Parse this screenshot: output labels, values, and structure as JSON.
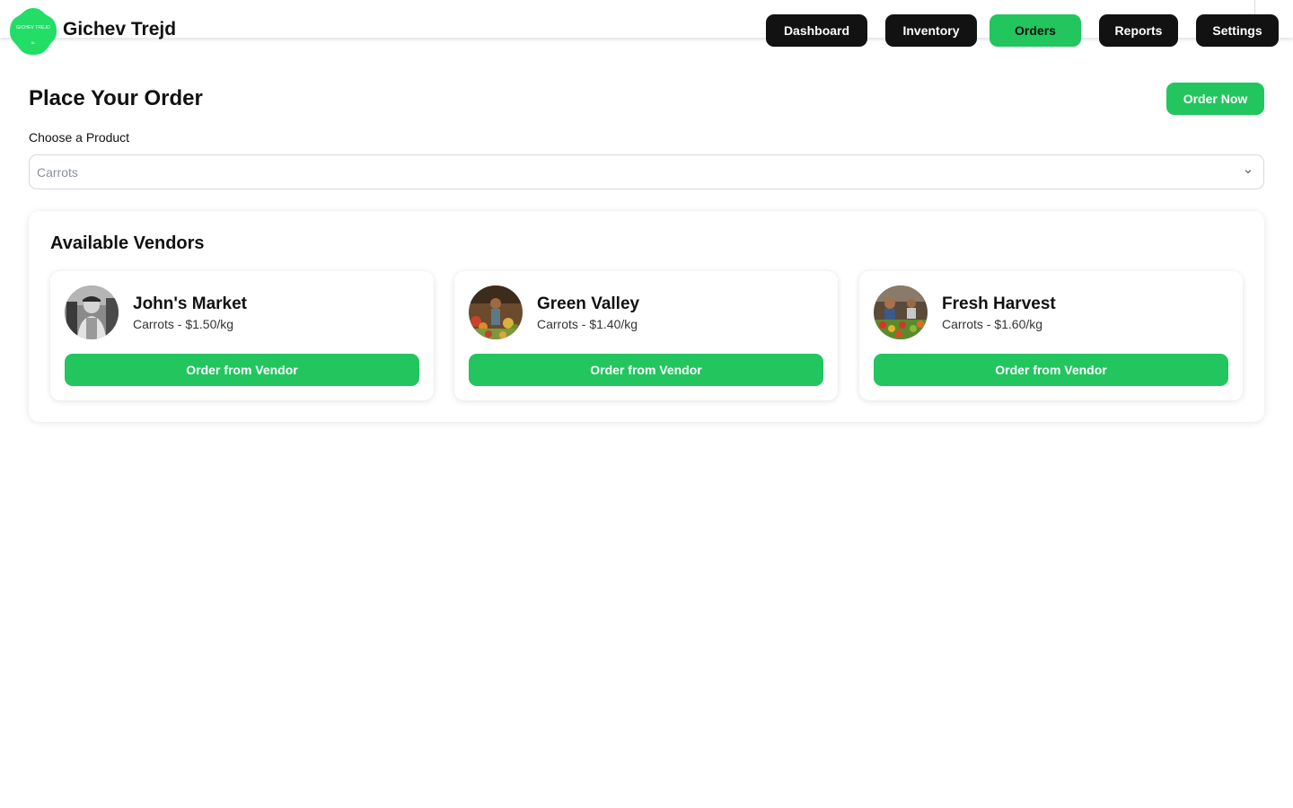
{
  "brand": {
    "logo_text": "GICHEV TREJD",
    "logo_sub": "SL",
    "name": "Gichev Trejd"
  },
  "nav": {
    "items": [
      {
        "label": "Dashboard",
        "active": false
      },
      {
        "label": "Inventory",
        "active": false
      },
      {
        "label": "Orders",
        "active": true
      },
      {
        "label": "Reports",
        "active": false
      },
      {
        "label": "Settings",
        "active": false
      }
    ]
  },
  "page": {
    "title": "Place Your Order",
    "order_now_label": "Order Now"
  },
  "product_select": {
    "label": "Choose a Product",
    "value": "Carrots",
    "icon": "chevron-down-icon"
  },
  "vendors": {
    "title": "Available Vendors",
    "items": [
      {
        "name": "John's Market",
        "price": "Carrots - $1.50/kg",
        "button": "Order from Vendor"
      },
      {
        "name": "Green Valley",
        "price": "Carrots - $1.40/kg",
        "button": "Order from Vendor"
      },
      {
        "name": "Fresh Harvest",
        "price": "Carrots - $1.60/kg",
        "button": "Order from Vendor"
      }
    ]
  },
  "colors": {
    "accent": "#22c55e",
    "nav_dark": "#121212",
    "text": "#111111",
    "placeholder": "#8a92a0"
  }
}
